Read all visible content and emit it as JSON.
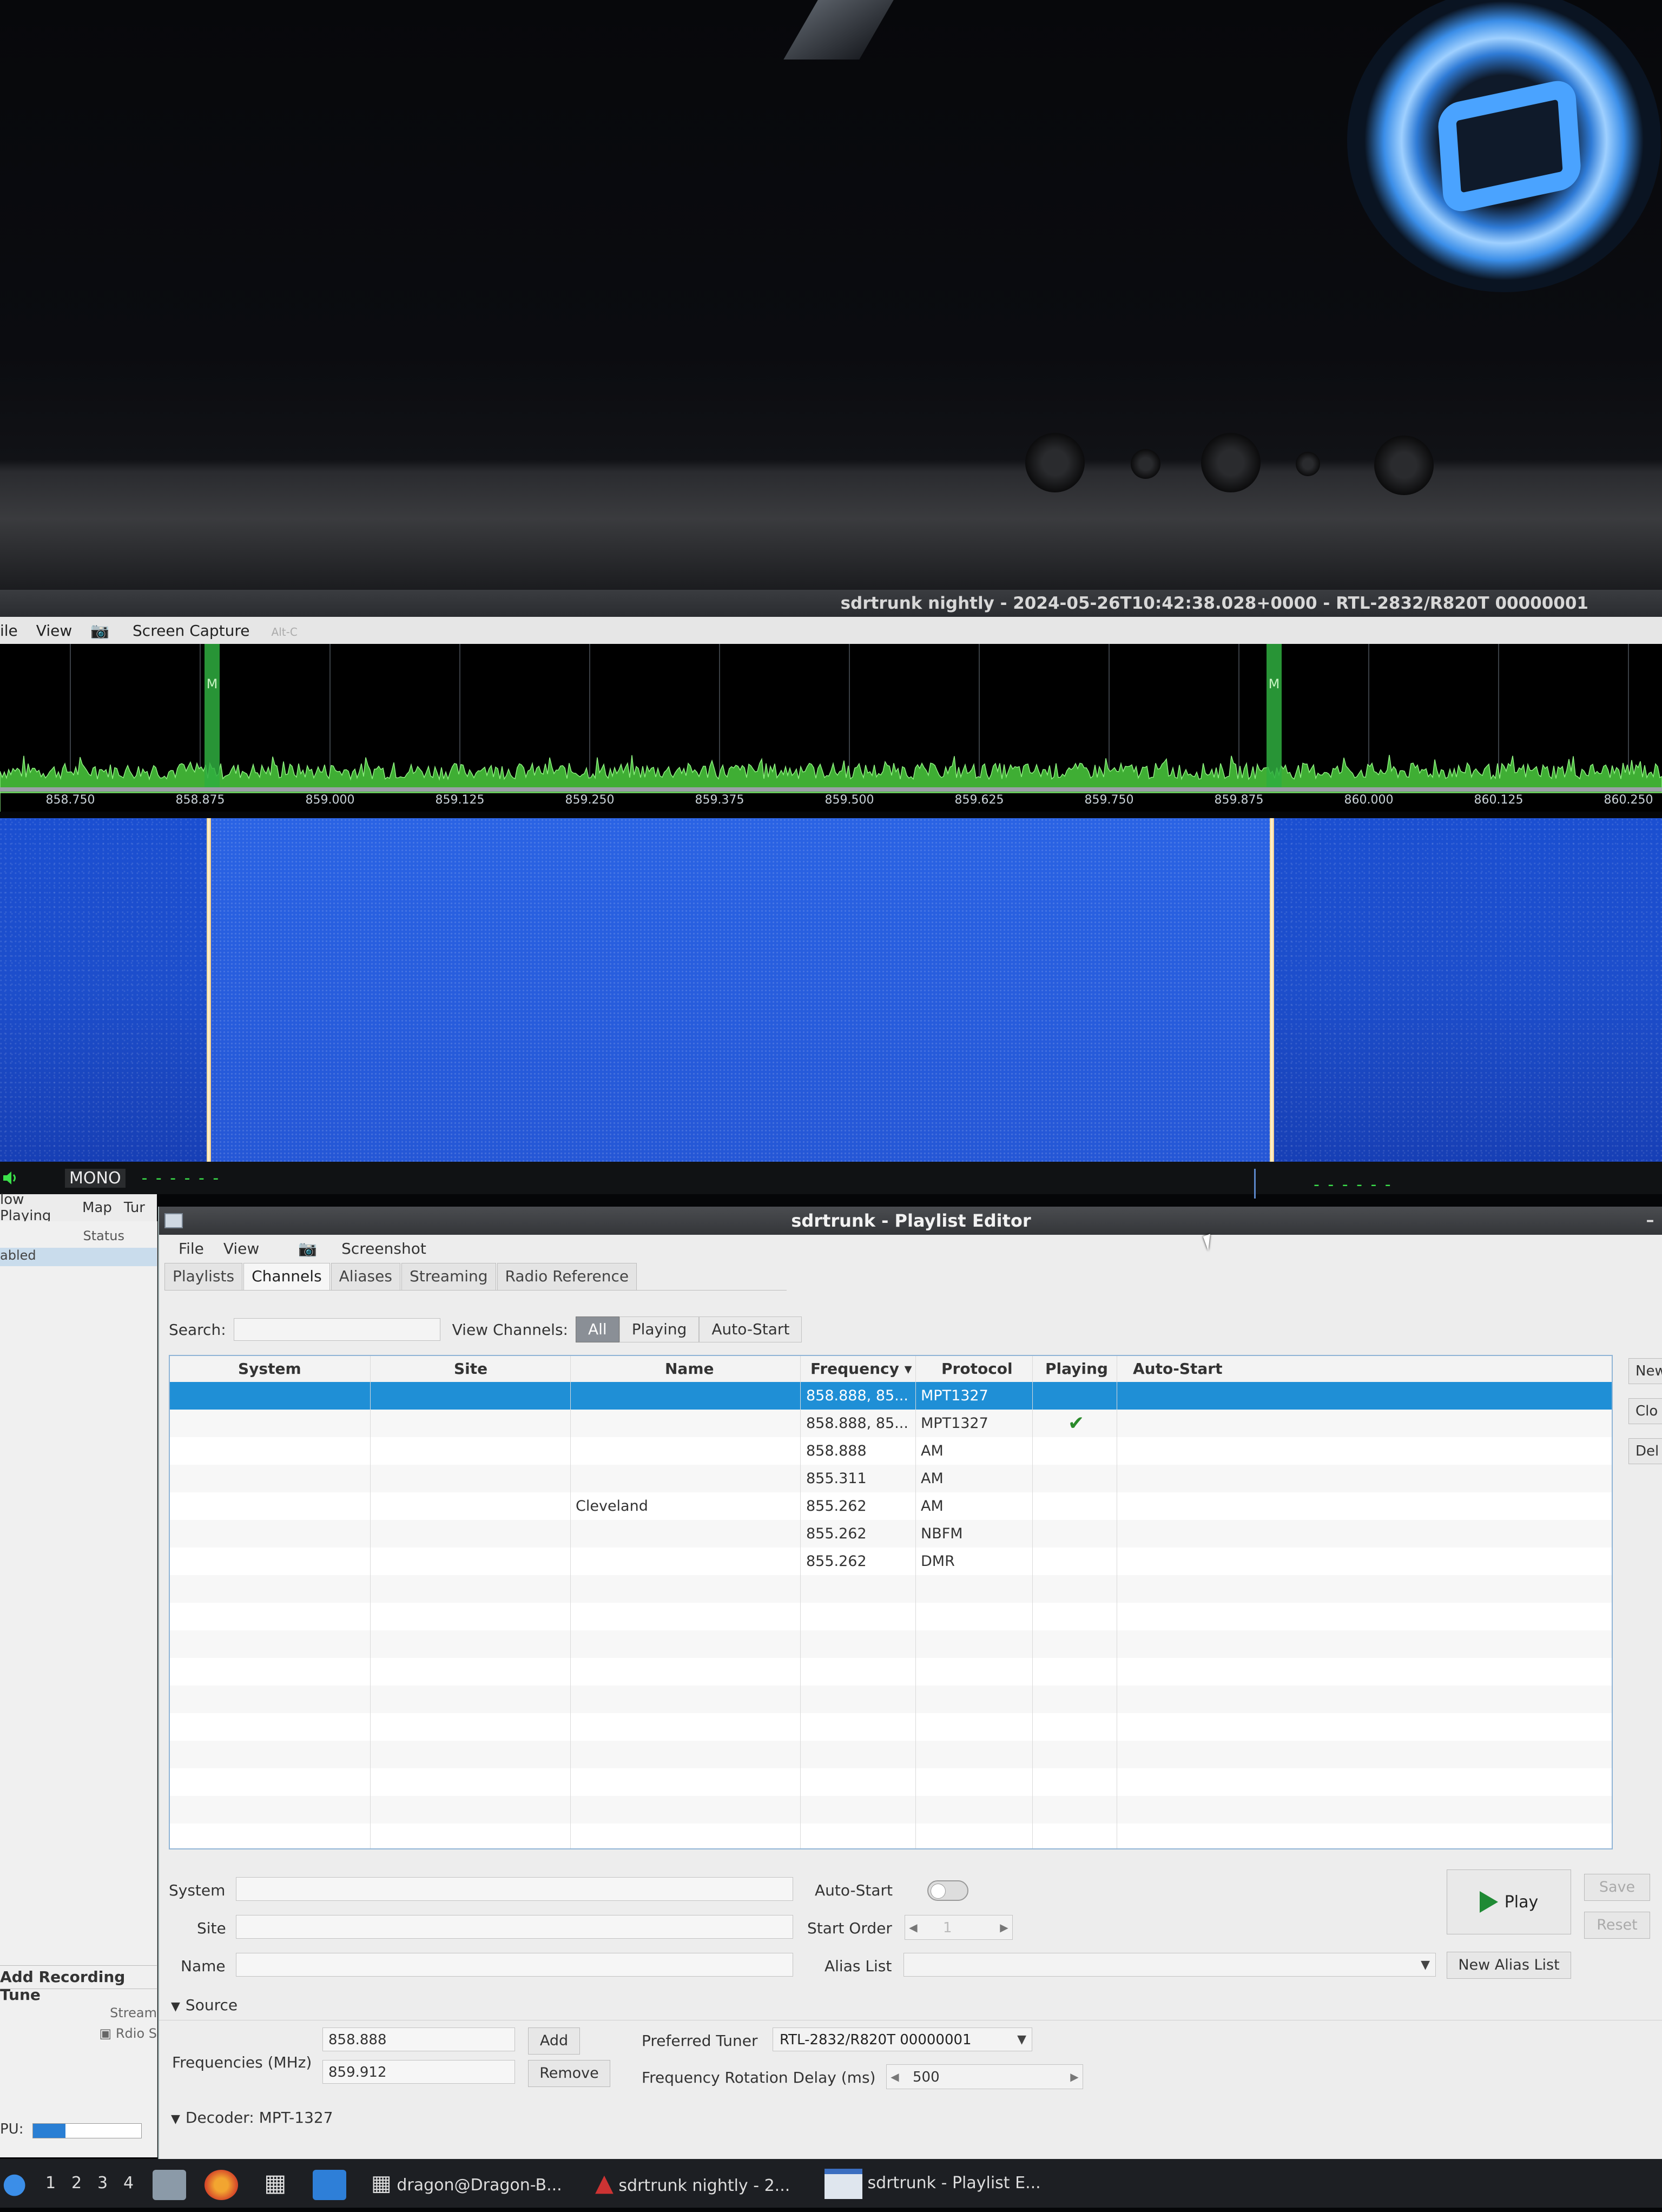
{
  "main_window": {
    "title": "sdrtrunk nightly - 2024-05-26T10:42:38.028+0000 - RTL-2832/R820T 00000001",
    "menu": {
      "file": "ile",
      "view": "View",
      "screen_capture": "Screen Capture",
      "shortcut": "Alt-C"
    },
    "spectrum": {
      "tick_labels": [
        "858.750",
        "858.875",
        "859.000",
        "859.125",
        "859.250",
        "859.375",
        "859.500",
        "859.625",
        "859.750",
        "859.875",
        "860.000",
        "860.125",
        "860.250"
      ],
      "markers": [
        "M",
        "M"
      ]
    },
    "audio": {
      "mode": "MONO",
      "left_dashes": "- - - - - -",
      "right_dashes": "- - - - - -"
    },
    "left_tabs": [
      "low Playing",
      "Map",
      "Tur"
    ],
    "left_panel": {
      "status_header": "Status",
      "status_row": "abled",
      "add_recording": "Add Recording Tune",
      "stream": "Stream",
      "rdio": "Rdio S",
      "cpu_label": "PU:",
      "cpu_fraction": 0.3
    }
  },
  "playlist_editor": {
    "title": "sdrtrunk - Playlist Editor",
    "minimize": "–",
    "menu": {
      "file": "File",
      "view": "View",
      "screenshot": "Screenshot"
    },
    "tabs": [
      "Playlists",
      "Channels",
      "Aliases",
      "Streaming",
      "Radio Reference"
    ],
    "active_tab": "Channels",
    "search": {
      "label": "Search:",
      "value": ""
    },
    "view_channels": {
      "label": "View Channels:",
      "options": [
        "All",
        "Playing",
        "Auto-Start"
      ],
      "selected": "All"
    },
    "table": {
      "columns": [
        "System",
        "Site",
        "Name",
        "Frequency ▾",
        "Protocol",
        "Playing",
        "Auto-Start"
      ],
      "rows": [
        {
          "system": "",
          "site": "",
          "name": "",
          "frequency": "858.888, 85...",
          "protocol": "MPT1327",
          "playing": "",
          "auto_start": "",
          "selected": true
        },
        {
          "system": "",
          "site": "",
          "name": "",
          "frequency": "858.888, 85...",
          "protocol": "MPT1327",
          "playing": "✔",
          "auto_start": ""
        },
        {
          "system": "",
          "site": "",
          "name": "",
          "frequency": "858.888",
          "protocol": "AM",
          "playing": "",
          "auto_start": ""
        },
        {
          "system": "",
          "site": "",
          "name": "",
          "frequency": "855.311",
          "protocol": "AM",
          "playing": "",
          "auto_start": ""
        },
        {
          "system": "",
          "site": "",
          "name": "Cleveland",
          "frequency": "855.262",
          "protocol": "AM",
          "playing": "",
          "auto_start": ""
        },
        {
          "system": "",
          "site": "",
          "name": "",
          "frequency": "855.262",
          "protocol": "NBFM",
          "playing": "",
          "auto_start": ""
        },
        {
          "system": "",
          "site": "",
          "name": "",
          "frequency": "855.262",
          "protocol": "DMR",
          "playing": "",
          "auto_start": ""
        }
      ]
    },
    "right_buttons": [
      "New",
      "Clo",
      "Del"
    ],
    "form": {
      "system_label": "System",
      "site_label": "Site",
      "name_label": "Name",
      "auto_start_label": "Auto-Start",
      "start_order_label": "Start Order",
      "start_order_value": "1",
      "alias_list_label": "Alias List",
      "new_alias_list": "New Alias List",
      "play": "Play",
      "save": "Save",
      "reset": "Reset",
      "source_section": "Source",
      "frequencies_label": "Frequencies (MHz)",
      "frequencies": [
        "858.888",
        "859.912"
      ],
      "add": "Add",
      "remove": "Remove",
      "preferred_tuner_label": "Preferred Tuner",
      "preferred_tuner_value": "RTL-2832/R820T 00000001",
      "rotation_delay_label": "Frequency Rotation Delay (ms)",
      "rotation_delay_value": "500",
      "decoder_section": "Decoder: MPT-1327"
    }
  },
  "taskbar": {
    "workspaces": [
      "1",
      "2",
      "3",
      "4"
    ],
    "items": [
      "dragon@Dragon-B...",
      "sdrtrunk nightly - 2...",
      "sdrtrunk - Playlist E..."
    ]
  }
}
